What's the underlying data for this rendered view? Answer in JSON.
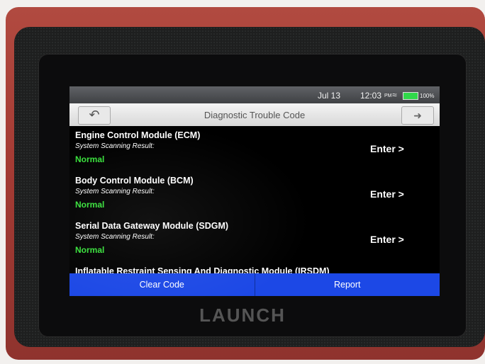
{
  "status_bar": {
    "date": "Jul 13",
    "time": "12:03",
    "ampm": "PM",
    "battery": "100%",
    "wifi_icon": "wifi-icon",
    "battery_icon": "battery-icon"
  },
  "header": {
    "title": "Diagnostic Trouble Code",
    "back_icon": "back-arrow-icon",
    "exit_icon": "exit-icon"
  },
  "modules": [
    {
      "name": "Engine Control Module (ECM)",
      "scan_label": "System Scanning Result:",
      "status": "Normal",
      "action": "Enter >"
    },
    {
      "name": "Body Control Module (BCM)",
      "scan_label": "System Scanning Result:",
      "status": "Normal",
      "action": "Enter >"
    },
    {
      "name": "Serial Data Gateway Module (SDGM)",
      "scan_label": "System Scanning Result:",
      "status": "Normal",
      "action": "Enter >"
    },
    {
      "name": "Inflatable Restraint Sensing And Diagnostic Module (IRSDM)"
    }
  ],
  "footer": {
    "clear_code": "Clear Code",
    "report": "Report"
  },
  "device": {
    "brand": "LAUNCH"
  },
  "colors": {
    "status_normal": "#37e03a",
    "footer_bar": "#1c48e6",
    "device_body": "#a43b34"
  }
}
